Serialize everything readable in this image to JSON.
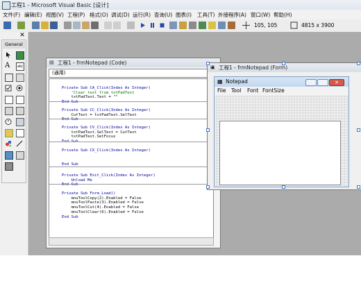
{
  "app": {
    "title": "工程1 - Microsoft Visual Basic [设计]"
  },
  "menu": [
    "文件(F)",
    "编辑(E)",
    "视图(V)",
    "工程(P)",
    "格式(O)",
    "调试(D)",
    "运行(R)",
    "查询(U)",
    "图表(I)",
    "工具(T)",
    "外接程序(A)",
    "窗口(W)",
    "帮助(H)"
  ],
  "toolbar": {
    "position": "105, 105",
    "size": "4815 x 3900"
  },
  "toolbox": {
    "title": "General",
    "tools": [
      "pointer-icon",
      "picturebox-icon",
      "label-icon",
      "textbox-icon",
      "frame-icon",
      "commandbutton-icon",
      "checkbox-icon",
      "optionbutton-icon",
      "combobox-icon",
      "listbox-icon",
      "hscrollbar-icon",
      "vscrollbar-icon",
      "timer-icon",
      "drivelist-icon",
      "dirlist-icon",
      "filelist-icon",
      "shape-icon",
      "line-icon",
      "image-icon",
      "data-icon",
      "ole-icon"
    ]
  },
  "code_window": {
    "title": "工程1 - frmNotepad (Code)",
    "object_combo": "(通用)",
    "procedures": [
      {
        "lines": [
          "Private Sub CA_Click(Index As Integer)",
          "    'Clear text from txtPadText",
          "    txtPadText.Text = \"\"",
          "End Sub"
        ]
      },
      {
        "lines": [
          "Private Sub CC_Click(Index As Integer)",
          "    CutText = txtPadText.SelText",
          "End Sub"
        ]
      },
      {
        "lines": [
          "Private Sub CV_Click(Index As Integer)",
          "    txtPadText.SelText = CutText",
          "    txtPadText.SetFocus",
          "End Sub"
        ]
      },
      {
        "lines": [
          "Private Sub CX_Click(Index As Integer)",
          "",
          "",
          "End Sub"
        ]
      },
      {
        "lines": [
          "Private Sub Exit_Click(Index As Integer)",
          "    Unload Me",
          "End Sub"
        ]
      },
      {
        "lines": [
          "Private Sub Form_Load()",
          "    mnuToolCopy(2).Enabled = False",
          "    mnuToolPaste(3).Enabled = False",
          "    mnuToolCut(4).Enabled = False",
          "    mnuToolClear(6).Enabled = False",
          "End Sub"
        ]
      }
    ]
  },
  "form_window": {
    "title": "工程1 - frmNotepad (Form)",
    "form_caption": "Notepad",
    "form_menu": [
      "File",
      "Tool",
      "Font",
      "FontSize"
    ]
  }
}
